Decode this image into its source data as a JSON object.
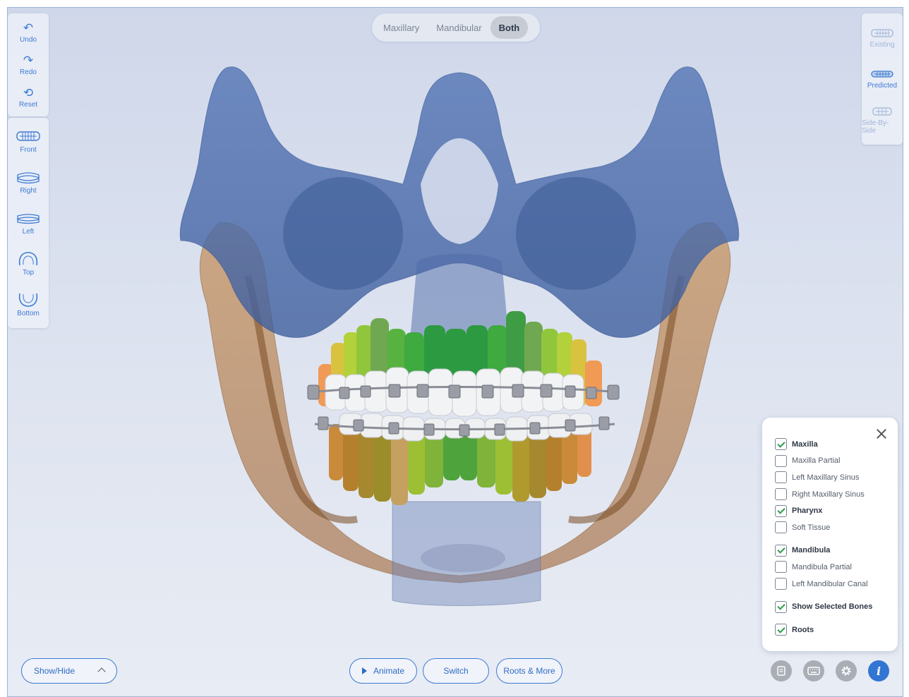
{
  "left_toolbar": {
    "history": [
      {
        "label": "Undo",
        "icon": "undo-icon",
        "glyph": "↶"
      },
      {
        "label": "Redo",
        "icon": "redo-icon",
        "glyph": "↷"
      },
      {
        "label": "Reset",
        "icon": "reset-icon",
        "glyph": "⟲"
      }
    ],
    "views": [
      {
        "label": "Front",
        "icon": "teeth-front-icon"
      },
      {
        "label": "Right",
        "icon": "teeth-right-icon"
      },
      {
        "label": "Left",
        "icon": "teeth-left-icon"
      },
      {
        "label": "Top",
        "icon": "teeth-top-icon"
      },
      {
        "label": "Bottom",
        "icon": "teeth-bottom-icon"
      }
    ]
  },
  "jaw_selector": {
    "options": [
      "Maxillary",
      "Mandibular",
      "Both"
    ],
    "selected": "Both"
  },
  "right_toolbar": {
    "items": [
      {
        "label": "Existing",
        "icon": "teeth-existing-icon",
        "active": false
      },
      {
        "label": "Predicted",
        "icon": "teeth-predicted-icon",
        "active": true
      },
      {
        "label": "Side-By-Side",
        "icon": "teeth-side-by-side-icon",
        "active": false
      }
    ]
  },
  "layers": {
    "items": [
      {
        "label": "Maxilla",
        "checked": true,
        "bold": true
      },
      {
        "label": "Maxilla Partial",
        "checked": false,
        "bold": false
      },
      {
        "label": "Left Maxillary Sinus",
        "checked": false,
        "bold": false
      },
      {
        "label": "Right Maxillary Sinus",
        "checked": false,
        "bold": false
      },
      {
        "label": "Pharynx",
        "checked": true,
        "bold": true
      },
      {
        "label": "Soft Tissue",
        "checked": false,
        "bold": false
      },
      {
        "label": "Mandibula",
        "checked": true,
        "bold": true
      },
      {
        "label": "Mandibula Partial",
        "checked": false,
        "bold": false
      },
      {
        "label": "Left Mandibular Canal",
        "checked": false,
        "bold": false
      },
      {
        "label": "Show Selected Bones",
        "checked": true,
        "bold": true
      },
      {
        "label": "Roots",
        "checked": true,
        "bold": true
      }
    ]
  },
  "bottom_bar": {
    "show_hide_label": "Show/Hide",
    "animate_label": "Animate",
    "switch_label": "Switch",
    "roots_more_label": "Roots & More"
  },
  "colors": {
    "accent": "#3d7bd4",
    "maxilla_bone": "#5574b0",
    "mandible_bone": "#b9885c",
    "check_green": "#2e9b50"
  }
}
